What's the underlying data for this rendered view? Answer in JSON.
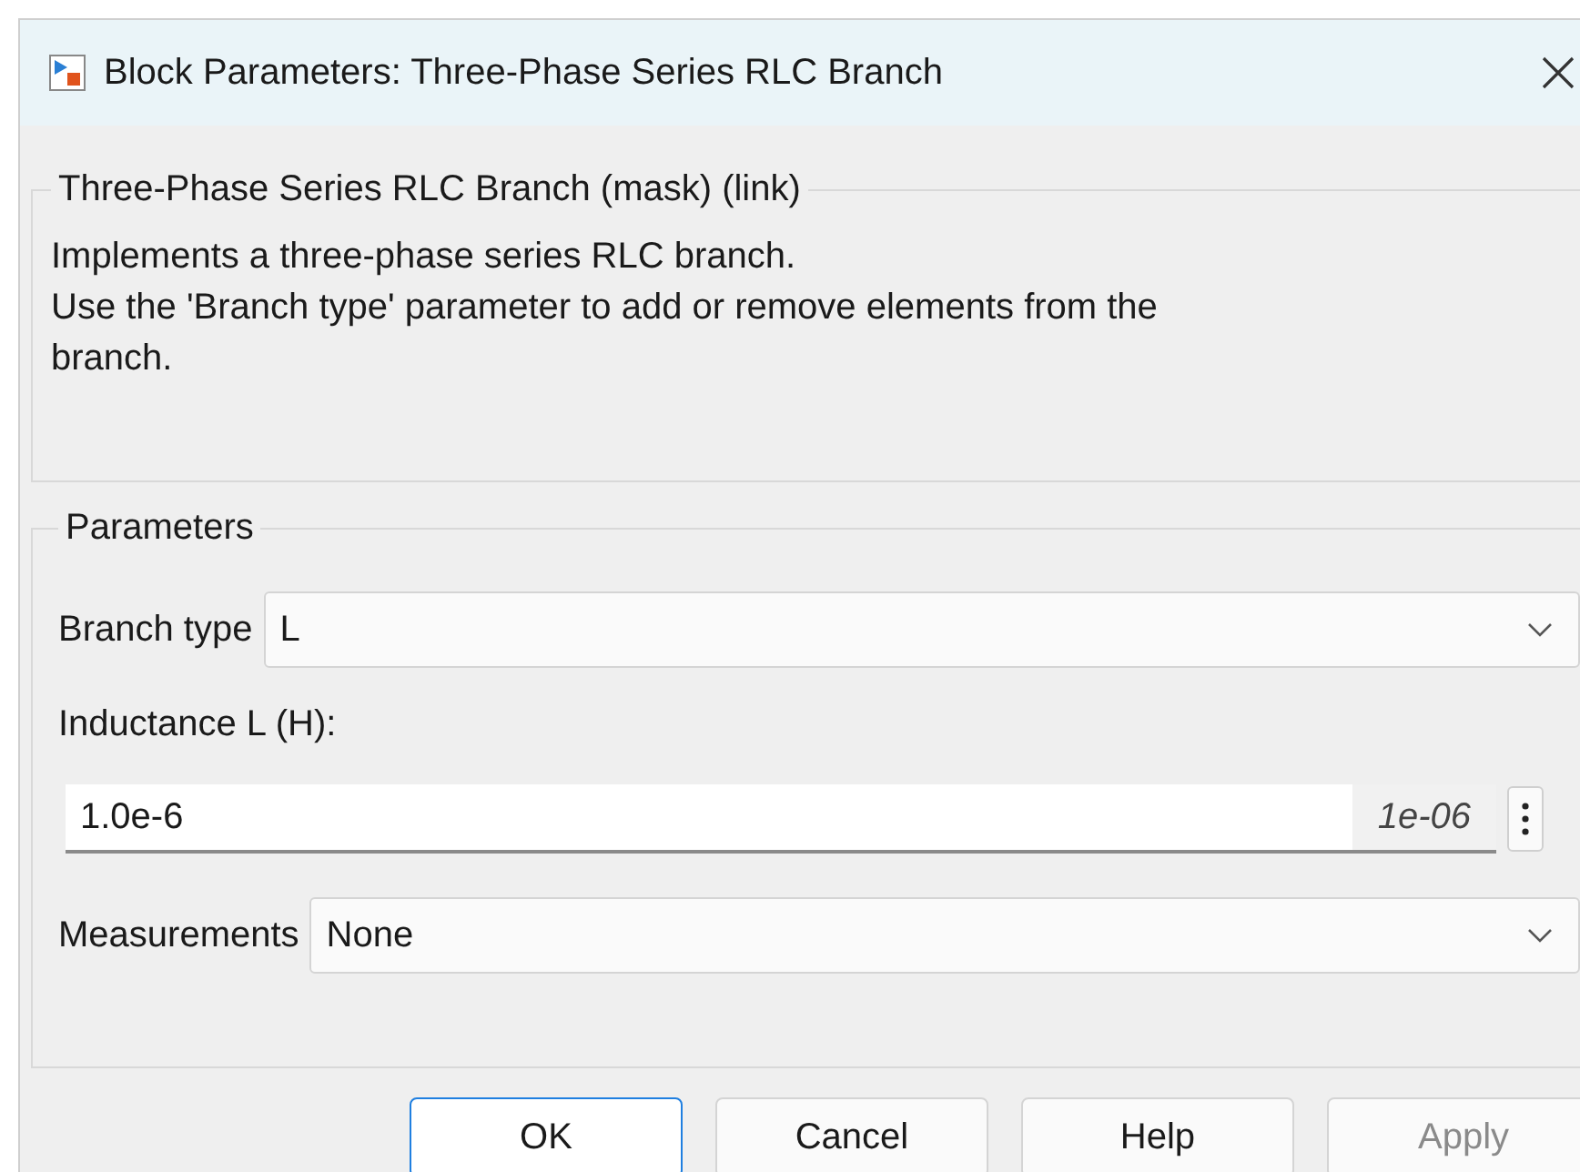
{
  "window": {
    "title": "Block Parameters: Three-Phase Series RLC Branch"
  },
  "description_group": {
    "title": "Three-Phase Series RLC Branch (mask) (link)",
    "lines": [
      "Implements a three-phase series RLC branch.",
      "Use the 'Branch type' parameter to add or remove elements from the",
      "branch."
    ]
  },
  "parameters_group": {
    "title": "Parameters",
    "branch_type": {
      "label": "Branch type",
      "value": "L"
    },
    "inductance": {
      "label": "Inductance L (H):",
      "value": "1.0e-6",
      "evaluated": "1e-06"
    },
    "measurements": {
      "label": "Measurements",
      "value": "None"
    }
  },
  "buttons": [
    {
      "label": "OK",
      "default": true,
      "disabled": false
    },
    {
      "label": "Cancel",
      "default": false,
      "disabled": false
    },
    {
      "label": "Help",
      "default": false,
      "disabled": false
    },
    {
      "label": "Apply",
      "default": false,
      "disabled": true
    }
  ]
}
